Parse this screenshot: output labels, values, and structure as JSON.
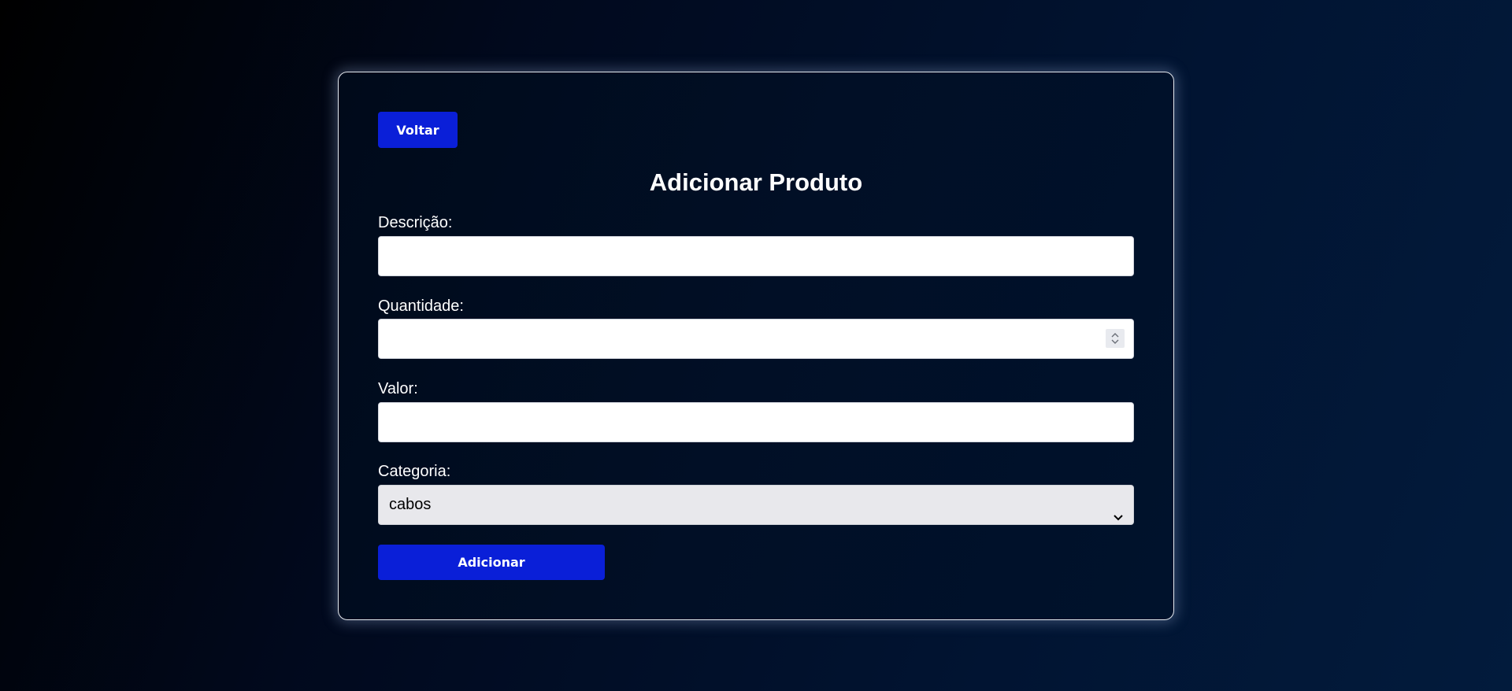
{
  "form": {
    "back_label": "Voltar",
    "title": "Adicionar Produto",
    "descricao_label": "Descrição:",
    "descricao_value": "",
    "quantidade_label": "Quantidade:",
    "quantidade_value": "",
    "valor_label": "Valor:",
    "valor_value": "",
    "categoria_label": "Categoria:",
    "categoria_selected": "cabos",
    "submit_label": "Adicionar"
  },
  "colors": {
    "button": "#0a1fd8",
    "background": "#01091d",
    "card_border": "#e6e9ef"
  },
  "icons": {
    "stepper": "up-down-stepper-icon",
    "select": "chevron-down-icon"
  }
}
